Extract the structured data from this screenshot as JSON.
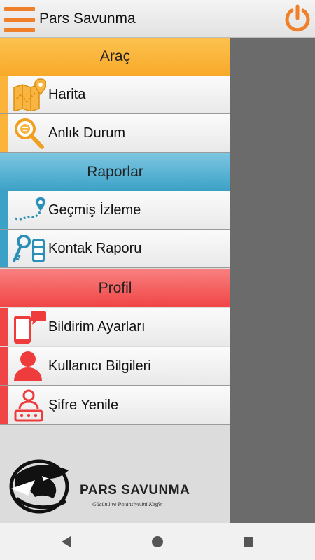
{
  "app_bar": {
    "title": "Pars Savunma",
    "menu_icon": "hamburger-icon",
    "power_icon": "power-icon",
    "accent_color": "#f07f2a"
  },
  "sections": [
    {
      "title": "Araç",
      "color": "#fbb33a",
      "items": [
        {
          "label": "Harita",
          "icon": "map-pin-icon"
        },
        {
          "label": "Anlık Durum",
          "icon": "search-location-icon"
        }
      ]
    },
    {
      "title": "Raporlar",
      "color": "#3ba1c6",
      "items": [
        {
          "label": "Geçmiş İzleme",
          "icon": "route-history-icon"
        },
        {
          "label": "Kontak Raporu",
          "icon": "car-key-icon"
        }
      ]
    },
    {
      "title": "Profil",
      "color": "#f04545",
      "items": [
        {
          "label": "Bildirim Ayarları",
          "icon": "phone-message-icon"
        },
        {
          "label": "Kullanıcı Bilgileri",
          "icon": "user-icon"
        },
        {
          "label": "Şifre Yenile",
          "icon": "user-password-icon"
        }
      ]
    }
  ],
  "brand": {
    "name": "PARS SAVUNMA",
    "slogan": "Gücünü ve Potansiyelini Keşfet"
  },
  "navbar": {
    "back_icon": "back-icon",
    "home_icon": "home-icon",
    "recents_icon": "recents-icon"
  }
}
